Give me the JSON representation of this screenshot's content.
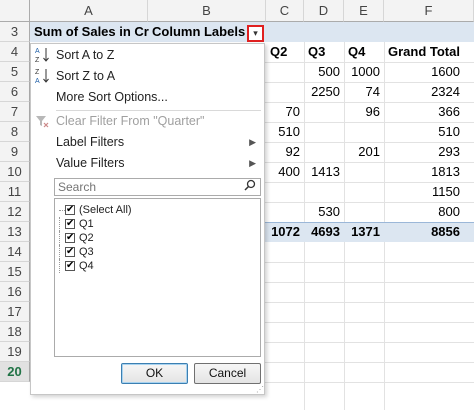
{
  "columns": [
    "A",
    "B",
    "C",
    "D",
    "E",
    "F"
  ],
  "rows": [
    "3",
    "4",
    "5",
    "6",
    "7",
    "8",
    "9",
    "10",
    "11",
    "12",
    "13",
    "14",
    "15",
    "16",
    "17",
    "18",
    "19",
    "20"
  ],
  "active_row": "20",
  "pivot": {
    "value_field_label": "Sum of Sales in Cr",
    "column_labels": "Column Labels",
    "headers": [
      "Q2",
      "Q3",
      "Q4",
      "Grand Total"
    ],
    "data": [
      [
        "",
        "500",
        "1000",
        "1600"
      ],
      [
        "",
        "2250",
        "74",
        "2324"
      ],
      [
        "70",
        "",
        "96",
        "366"
      ],
      [
        "510",
        "",
        "",
        "510"
      ],
      [
        "92",
        "",
        "201",
        "293"
      ],
      [
        "400",
        "1413",
        "",
        "1813"
      ],
      [
        "",
        "",
        "",
        "1150"
      ],
      [
        "",
        "530",
        "",
        "800"
      ]
    ],
    "totals": [
      "1072",
      "4693",
      "1371",
      "8856"
    ]
  },
  "menu": {
    "sort_a_z": "Sort A to Z",
    "sort_z_a": "Sort Z to A",
    "more_sort": "More Sort Options...",
    "clear_filter": "Clear Filter From \"Quarter\"",
    "label_filters": "Label Filters",
    "value_filters": "Value Filters",
    "search_placeholder": "Search",
    "items": [
      "(Select All)",
      "Q1",
      "Q2",
      "Q3",
      "Q4"
    ],
    "ok": "OK",
    "cancel": "Cancel"
  },
  "colors": {
    "header_band": "#dce6f1",
    "filter_highlight": "#e02020",
    "active_row": "#217346"
  }
}
